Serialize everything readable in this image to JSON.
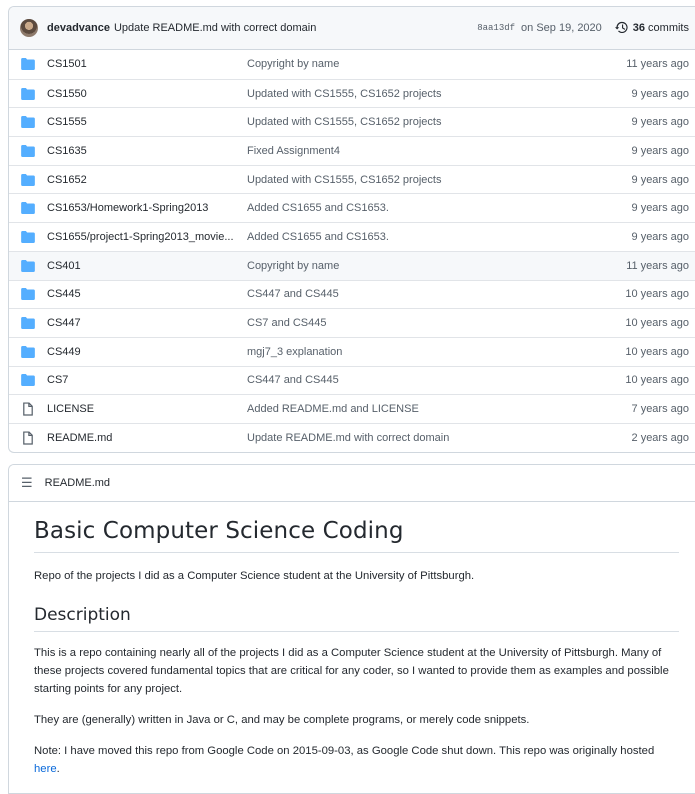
{
  "commit": {
    "author": "devadvance",
    "message": "Update README.md with correct domain",
    "sha": "8aa13df",
    "date": "on Sep 19, 2020",
    "count": "36",
    "count_label": "commits"
  },
  "files": [
    {
      "type": "dir",
      "name": "CS1501",
      "message": "Copyright by name",
      "age": "11 years ago"
    },
    {
      "type": "dir",
      "name": "CS1550",
      "message": "Updated with CS1555, CS1652 projects",
      "age": "9 years ago"
    },
    {
      "type": "dir",
      "name": "CS1555",
      "message": "Updated with CS1555, CS1652 projects",
      "age": "9 years ago"
    },
    {
      "type": "dir",
      "name": "CS1635",
      "message": "Fixed Assignment4",
      "age": "9 years ago"
    },
    {
      "type": "dir",
      "name": "CS1652",
      "message": "Updated with CS1555, CS1652 projects",
      "age": "9 years ago"
    },
    {
      "type": "dir",
      "name": "CS1653/Homework1-Spring2013",
      "message": "Added CS1655 and CS1653.",
      "age": "9 years ago"
    },
    {
      "type": "dir",
      "name": "CS1655/project1-Spring2013_movie...",
      "message": "Added CS1655 and CS1653.",
      "age": "9 years ago"
    },
    {
      "type": "dir",
      "name": "CS401",
      "message": "Copyright by name",
      "age": "11 years ago"
    },
    {
      "type": "dir",
      "name": "CS445",
      "message": "CS447 and CS445",
      "age": "10 years ago"
    },
    {
      "type": "dir",
      "name": "CS447",
      "message": "CS7 and CS445",
      "age": "10 years ago"
    },
    {
      "type": "dir",
      "name": "CS449",
      "message": "mgj7_3 explanation",
      "age": "10 years ago"
    },
    {
      "type": "dir",
      "name": "CS7",
      "message": "CS447 and CS445",
      "age": "10 years ago"
    },
    {
      "type": "file",
      "name": "LICENSE",
      "message": "Added README.md and LICENSE",
      "age": "7 years ago"
    },
    {
      "type": "file",
      "name": "README.md",
      "message": "Update README.md with correct domain",
      "age": "2 years ago"
    }
  ],
  "highlighted_row": 7,
  "readme": {
    "filename": "README.md",
    "title": "Basic Computer Science Coding",
    "intro": "Repo of the projects I did as a Computer Science student at the University of Pittsburgh.",
    "section_heading": "Description",
    "p1": "This is a repo containing nearly all of the projects I did as a Computer Science student at the University of Pittsburgh. Many of these projects covered fundamental topics that are critical for any coder, so I wanted to provide them as examples and possible starting points for any project.",
    "p2": "They are (generally) written in Java or C, and may be complete programs, or merely code snippets.",
    "p3_text": "Note: I have moved this repo from Google Code on 2015-09-03, as Google Code shut down. This repo was originally hosted ",
    "p3_link": "here",
    "p3_end": "."
  },
  "icons": {
    "folder": "folder-icon",
    "file": "file-icon",
    "history": "history-icon",
    "list": "list-unordered-icon"
  },
  "colors": {
    "folder": "#54aeff",
    "link": "#0969da",
    "muted": "#57606a",
    "border": "#d0d7de"
  }
}
